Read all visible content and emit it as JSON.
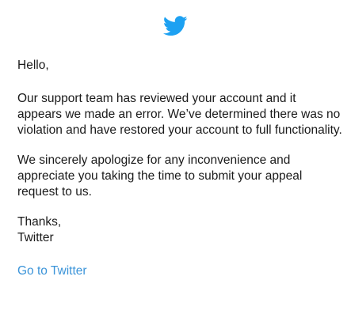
{
  "brand": {
    "logo_icon": "twitter-bird-icon",
    "accent_color": "#1DA1F2",
    "link_color": "#3B94D9"
  },
  "email": {
    "greeting": "Hello,",
    "paragraph_1": "Our support team has reviewed your account and it appears we made an error. We’ve determined there was no violation and have restored your account to full functionality.",
    "paragraph_2": "We sincerely apologize for any inconvenience and appreciate you taking the time to submit your appeal request to us.",
    "signoff_line_1": "Thanks,",
    "signoff_line_2": "Twitter",
    "cta_link_label": "Go to Twitter"
  }
}
